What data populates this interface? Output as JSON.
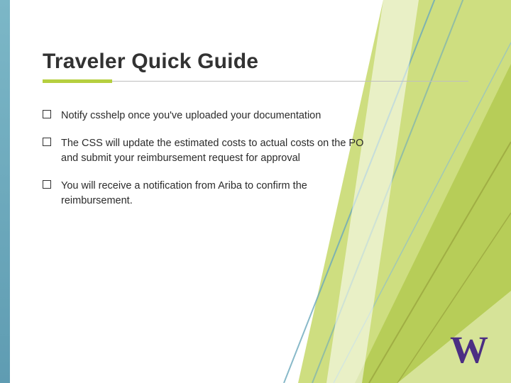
{
  "title": "Traveler Quick Guide",
  "bullets": [
    "Notify csshelp once you've uploaded your documentation",
    "The CSS will update the estimated costs to actual costs on the PO and submit your reimbursement request for approval",
    "You will receive a notification from Ariba to confirm the reimbursement."
  ],
  "logo_text": "W",
  "colors": {
    "accent": "#b6cf3f",
    "brand": "#4b2e83",
    "teal": "#5f9cb2"
  }
}
